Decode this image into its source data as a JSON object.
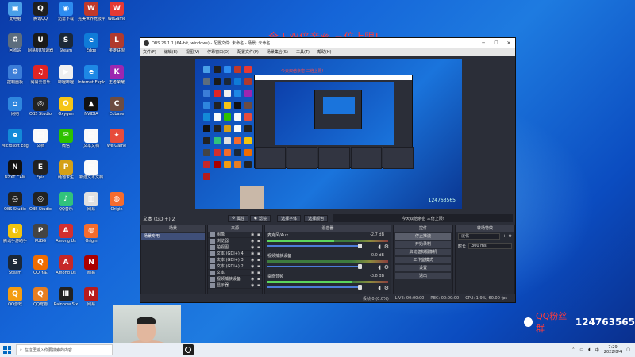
{
  "desktop": {
    "icons": [
      {
        "label": "此电脑",
        "color": "#4a9fe8",
        "glyph": "▣",
        "col": 0,
        "row": 0
      },
      {
        "label": "腾讯QQ",
        "color": "#1f1f1f",
        "glyph": "Q",
        "col": 1,
        "row": 0
      },
      {
        "label": "迅雷下载",
        "color": "#2d8cf0",
        "glyph": "◉",
        "col": 2,
        "row": 0
      },
      {
        "label": "完美世界竞技平台",
        "color": "#c0392b",
        "glyph": "W",
        "col": 3,
        "row": 0
      },
      {
        "label": "WeGame",
        "color": "#e53935",
        "glyph": "W",
        "col": 4,
        "row": 0
      },
      {
        "label": "回收站",
        "color": "#5d6d7e",
        "glyph": "♻",
        "col": 0,
        "row": 1
      },
      {
        "label": "网易UU加速器",
        "color": "#1a1a1a",
        "glyph": "U",
        "col": 1,
        "row": 1
      },
      {
        "label": "Steam",
        "color": "#1b2838",
        "glyph": "S",
        "col": 2,
        "row": 1
      },
      {
        "label": "Edge",
        "color": "#0f7bd8",
        "glyph": "e",
        "col": 3,
        "row": 1
      },
      {
        "label": "英雄联盟",
        "color": "#b03a2e",
        "glyph": "L",
        "col": 4,
        "row": 1
      },
      {
        "label": "控制面板",
        "color": "#3b7dd8",
        "glyph": "⚙",
        "col": 0,
        "row": 2
      },
      {
        "label": "网易云音乐",
        "color": "#e02424",
        "glyph": "♫",
        "col": 1,
        "row": 2
      },
      {
        "label": "哔哩哔哩",
        "color": "#f0f0f0",
        "glyph": "▶",
        "col": 2,
        "row": 2
      },
      {
        "label": "Internet Explorer",
        "color": "#1e88e5",
        "glyph": "e",
        "col": 3,
        "row": 2
      },
      {
        "label": "王者荣耀",
        "color": "#9c27b0",
        "glyph": "K",
        "col": 4,
        "row": 2
      },
      {
        "label": "网络",
        "color": "#2e86de",
        "glyph": "⌂",
        "col": 0,
        "row": 3
      },
      {
        "label": "OBS Studio",
        "color": "#222",
        "glyph": "◎",
        "col": 1,
        "row": 3
      },
      {
        "label": "Oxygen",
        "color": "#f5c518",
        "glyph": "O",
        "col": 2,
        "row": 3
      },
      {
        "label": "NVIDIA",
        "color": "#111",
        "glyph": "▲",
        "col": 3,
        "row": 3
      },
      {
        "label": "Cubase",
        "color": "#6d4c41",
        "glyph": "C",
        "col": 4,
        "row": 3
      },
      {
        "label": "Microsoft Edge",
        "color": "#138ad8",
        "glyph": "e",
        "col": 0,
        "row": 4
      },
      {
        "label": "文档",
        "color": "#fafafa",
        "glyph": "▤",
        "col": 1,
        "row": 4
      },
      {
        "label": "微信",
        "color": "#2dc100",
        "glyph": "✉",
        "col": 2,
        "row": 4
      },
      {
        "label": "文本文档",
        "color": "#fafafa",
        "glyph": "▤",
        "col": 3,
        "row": 4
      },
      {
        "label": "We Game",
        "color": "#e74c3c",
        "glyph": "✦",
        "col": 4,
        "row": 4
      },
      {
        "label": "NZXT CAM",
        "color": "#111",
        "glyph": "N",
        "col": 0,
        "row": 5
      },
      {
        "label": "Epic",
        "color": "#222",
        "glyph": "E",
        "col": 1,
        "row": 5
      },
      {
        "label": "绝地求生",
        "color": "#d4a017",
        "glyph": "P",
        "col": 2,
        "row": 5
      },
      {
        "label": "新建文本文档",
        "color": "#fafafa",
        "glyph": "▤",
        "col": 3,
        "row": 5
      },
      {
        "label": "OBS Studio",
        "color": "#222",
        "glyph": "◎",
        "col": 0,
        "row": 6
      },
      {
        "label": "OBS Studio",
        "color": "#222",
        "glyph": "◎",
        "col": 1,
        "row": 6
      },
      {
        "label": "QQ音乐",
        "color": "#31c27c",
        "glyph": "♪",
        "col": 2,
        "row": 6
      },
      {
        "label": "网易",
        "color": "#e0e0e0",
        "glyph": "▥",
        "col": 3,
        "row": 6
      },
      {
        "label": "Origin",
        "color": "#f56c2d",
        "glyph": "◍",
        "col": 4,
        "row": 6
      },
      {
        "label": "腾讯手游助手",
        "color": "#f1c40f",
        "glyph": "◐",
        "col": 0,
        "row": 7
      },
      {
        "label": "PUBG",
        "color": "#444",
        "glyph": "P",
        "col": 1,
        "row": 7
      },
      {
        "label": "Among Us",
        "color": "#d32f2f",
        "glyph": "A",
        "col": 2,
        "row": 7
      },
      {
        "label": "Origin",
        "color": "#f56c2d",
        "glyph": "◍",
        "col": 3,
        "row": 7
      },
      {
        "label": "Steam",
        "color": "#1b2838",
        "glyph": "S",
        "col": 0,
        "row": 8
      },
      {
        "label": "QQ飞车",
        "color": "#ef6c00",
        "glyph": "Q",
        "col": 1,
        "row": 8
      },
      {
        "label": "Among Us",
        "color": "#c62828",
        "glyph": "A",
        "col": 2,
        "row": 8
      },
      {
        "label": "网易",
        "color": "#a00",
        "glyph": "N",
        "col": 3,
        "row": 8
      },
      {
        "label": "QQ游戏",
        "color": "#f39c12",
        "glyph": "Q",
        "col": 0,
        "row": 9
      },
      {
        "label": "QQ宠物",
        "color": "#e67e22",
        "glyph": "Q",
        "col": 1,
        "row": 9
      },
      {
        "label": "Rainbow Six",
        "color": "#222",
        "glyph": "Ⅲ",
        "col": 2,
        "row": 9
      },
      {
        "label": "网易",
        "color": "#b71c1c",
        "glyph": "N",
        "col": 3,
        "row": 9
      }
    ]
  },
  "overlay_title": "今天双倍亲密 三倍上限!",
  "obs": {
    "title": "OBS 26.1.1 (64-bit, windows) - 配置文件: 未命名 - 场景: 未命名",
    "menu": [
      "文件(F)",
      "编辑(E)",
      "视图(V)",
      "停靠窗口(D)",
      "配置文件(P)",
      "场景集合(S)",
      "工具(T)",
      "帮助(H)"
    ],
    "preview_qq_number": "124763565",
    "preview_red_text": "今天双倍亲密 三倍上限!",
    "source_selected": "文本 (GDI+) 2",
    "props_button": "属性",
    "filters_button": "滤镜",
    "choose_font_button": "选择字体",
    "choose_color_button": "选择颜色",
    "ticker_text": "今天双倍亲密 三倍上限!",
    "docks": {
      "scenes": {
        "title": "场景",
        "items": [
          "场景专用"
        ]
      },
      "sources": {
        "title": "来源",
        "items": [
          "图像",
          "浏览器",
          "拍视图",
          "文本 (GDI+) 4",
          "文本 (GDI+) 3",
          "文本 (GDI+) 2",
          "文本",
          "视频捕获设备",
          "显示器"
        ]
      },
      "mixer": {
        "title": "混音器",
        "channels": [
          {
            "name": "麦克风/Aux",
            "db": "-2.7 dB",
            "level": 0.55
          },
          {
            "name": "视频捕获设备",
            "db": "0.0 dB",
            "level": 0.0
          },
          {
            "name": "桌面音频",
            "db": "-3.8 dB",
            "level": 0.7
          }
        ]
      },
      "transitions": {
        "title": "转场特效",
        "type": "淡化",
        "duration_label": "时长",
        "duration": "300 ms"
      },
      "controls": {
        "title": "控件",
        "buttons": [
          "停止推流",
          "开始录制",
          "启动虚拟摄像机",
          "工作室模式",
          "设置",
          "退出"
        ]
      }
    },
    "status": {
      "dropped": "丢帧 0 (0.0%)",
      "live": "LIVE: 00:00:00",
      "rec": "REC: 00:00:00",
      "cpu": "CPU: 1.9%, 60.00 fps"
    }
  },
  "qq_group": {
    "label": "QQ粉丝群",
    "number": "124763565"
  },
  "taskbar": {
    "search_placeholder": "在这里输入你要搜索的内容",
    "time": "7:29",
    "date": "2022/8/4",
    "lang": "中"
  }
}
